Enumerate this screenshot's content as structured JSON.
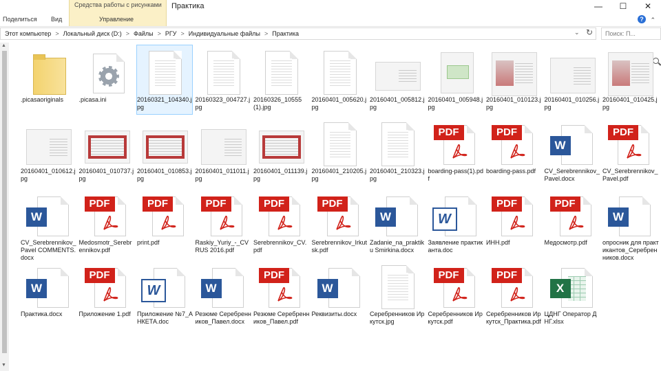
{
  "ribbon": {
    "context_group": "Средства работы с рисунками",
    "window_title": "Практика",
    "tabs": [
      "Поделиться",
      "Вид",
      "Управление"
    ],
    "win_minimize": "—",
    "win_maximize": "☐",
    "win_close": "✕",
    "help": "?",
    "collapse": "⌃"
  },
  "address": {
    "crumbs": [
      "Этот компьютер",
      "Локальный диск (D:)",
      "Файлы",
      "РГУ",
      "Индивидуальные файлы",
      "Практика"
    ],
    "separator": ">",
    "dropdown": "⌄",
    "refresh": "↻",
    "search_placeholder": "Поиск: П..."
  },
  "files": [
    {
      "name": ".picasaoriginals",
      "type": "folder"
    },
    {
      "name": ".picasa.ini",
      "type": "ini"
    },
    {
      "name": "20160321_104340.jpg",
      "type": "scan",
      "selected": true
    },
    {
      "name": "20160323_004727.jpg",
      "type": "scan"
    },
    {
      "name": "20160326_10555(1).jpg",
      "type": "scan"
    },
    {
      "name": "20160401_005620.jpg",
      "type": "scan"
    },
    {
      "name": "20160401_005812.jpg",
      "type": "scanwide"
    },
    {
      "name": "20160401_005948.jpg",
      "type": "greencard"
    },
    {
      "name": "20160401_010123.jpg",
      "type": "passport"
    },
    {
      "name": "20160401_010256.jpg",
      "type": "photo"
    },
    {
      "name": "20160401_010425.jpg",
      "type": "passport"
    },
    {
      "name": "20160401_010612.jpg",
      "type": "photo"
    },
    {
      "name": "20160401_010737.jpg",
      "type": "redbook"
    },
    {
      "name": "20160401_010853.jpg",
      "type": "redbook"
    },
    {
      "name": "20160401_011011.jpg",
      "type": "photo"
    },
    {
      "name": "20160401_011139.jpg",
      "type": "redbook"
    },
    {
      "name": "20160401_210205.jpg",
      "type": "scan"
    },
    {
      "name": "20160401_210323.jpg",
      "type": "scan"
    },
    {
      "name": "boarding-pass(1).pdf",
      "type": "pdf"
    },
    {
      "name": "boarding-pass.pdf",
      "type": "pdf"
    },
    {
      "name": "CV_Serebrennikov_Pavel.docx",
      "type": "word"
    },
    {
      "name": "CV_Serebrennikov_Pavel.pdf",
      "type": "pdf"
    },
    {
      "name": "CV_Serebrennikov_Pavel COMMENTS.docx",
      "type": "word"
    },
    {
      "name": "Medosmotr_Serebrennikov.pdf",
      "type": "pdf"
    },
    {
      "name": "print.pdf",
      "type": "pdf"
    },
    {
      "name": "Raskiy_Yuriy_-_CV RUS 2016.pdf",
      "type": "pdf"
    },
    {
      "name": "Serebrennikov_CV.pdf",
      "type": "pdf"
    },
    {
      "name": "Serebrennikov_Irkutsk.pdf",
      "type": "pdf"
    },
    {
      "name": "Zadanie_na_praktiku Smirkina.docx",
      "type": "word"
    },
    {
      "name": "Заявление практиканта.doc",
      "type": "wordold"
    },
    {
      "name": "ИНН.pdf",
      "type": "pdf"
    },
    {
      "name": "Медосмотр.pdf",
      "type": "pdf"
    },
    {
      "name": "опросник для практикантов_Серебренников.docx",
      "type": "word"
    },
    {
      "name": "Практика.docx",
      "type": "word"
    },
    {
      "name": "Приложение 1.pdf",
      "type": "pdf"
    },
    {
      "name": "Приложение №7_АНКЕТА.doc",
      "type": "wordold"
    },
    {
      "name": "Резюме Серебренников_Павел.docx",
      "type": "word"
    },
    {
      "name": "Резюме Серебренников_Павел.pdf",
      "type": "pdf"
    },
    {
      "name": "Реквизиты.docx",
      "type": "word"
    },
    {
      "name": "Серебренников Иркутск.jpg",
      "type": "scan"
    },
    {
      "name": "Серебренников Иркутск.pdf",
      "type": "pdf"
    },
    {
      "name": "Серебренников Иркутск_Практика.pdf",
      "type": "pdf"
    },
    {
      "name": "ЦДНГ Оператор ДНГ.xlsx",
      "type": "excel"
    }
  ],
  "colors": {
    "pdf_red": "#d1221a",
    "word_blue": "#2b579a",
    "excel_green": "#217346",
    "selection": "#e5f3ff",
    "context_tab": "#fbf0c7"
  }
}
